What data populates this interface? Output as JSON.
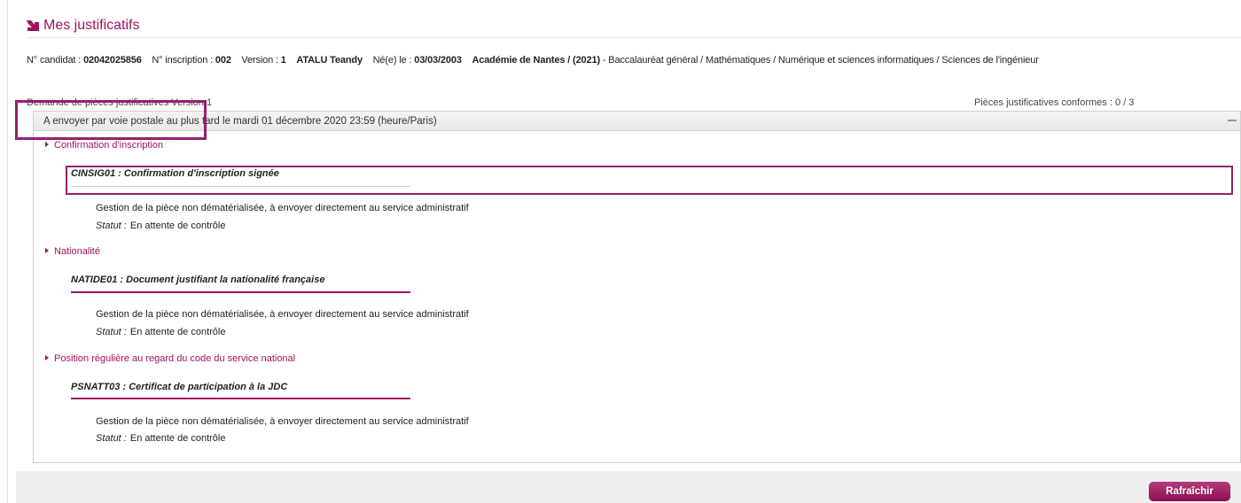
{
  "header": {
    "title": "Mes justificatifs"
  },
  "candidate": {
    "label_candidat": "N° candidat :",
    "candidat": "02042025856",
    "label_inscription": "N° inscription :",
    "inscription": "002",
    "label_version": "Version :",
    "version": "1",
    "name": "ATALU Teandy",
    "label_born": "Né(e) le :",
    "born": "03/03/2003",
    "academy": "Académie de Nantes / (2021)",
    "program": " - Baccalauréat général / Mathématiques / Numérique et sciences informatiques / Sciences de l'ingénieur"
  },
  "request": {
    "version_label": "Demande de pièces justificatives Version 1",
    "conformes": "Pièces justificatives conformes : 0 / 3"
  },
  "panel": {
    "deadline": "A envoyer par voie postale au plus tard le mardi 01 décembre 2020 23:59 (heure/Paris)",
    "sections": [
      {
        "title": "Confirmation d'inscription",
        "doc": "CINSIG01 : Confirmation d'inscription signée",
        "description": "Gestion de la pièce non dématérialisée, à envoyer directement au service administratif",
        "status_label": "Statut :",
        "status": "En attente de contrôle"
      },
      {
        "title": "Nationalité",
        "doc": "NATIDE01 : Document justifiant la nationalité française",
        "description": "Gestion de la pièce non dématérialisée, à envoyer directement au service administratif",
        "status_label": "Statut :",
        "status": "En attente de contrôle"
      },
      {
        "title": "Position régulière au regard du code du service national",
        "doc": "PSNATT03 : Certificat de participation à la JDC",
        "description": "Gestion de la pièce non dématérialisée, à envoyer directement au service administratif",
        "status_label": "Statut :",
        "status": "En attente de contrôle"
      }
    ]
  },
  "footer": {
    "refresh_label": "Rafraîchir"
  },
  "icons": {
    "title_icon": "arrow-down-right-icon",
    "collapse": "minus-icon",
    "section": "triangle-right-icon"
  },
  "colors": {
    "brand": "#a3125c"
  }
}
